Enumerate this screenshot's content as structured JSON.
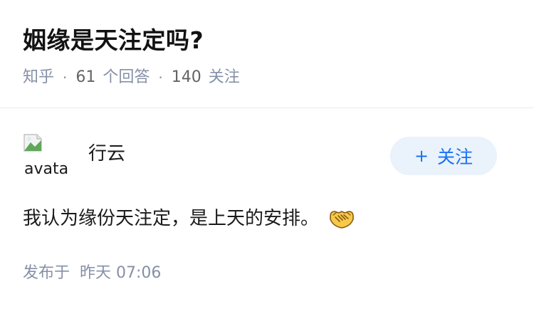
{
  "question": {
    "title": "姻缘是天注定吗?",
    "source": "知乎",
    "separator": "·",
    "answers_count": "61",
    "answers_label": "个回答",
    "followers_count": "140",
    "followers_label": "关注"
  },
  "answer": {
    "avatar_alt": "avatar",
    "author_name": "行云",
    "follow_button": {
      "plus": "+",
      "label": "关注"
    },
    "content": "我认为缘份天注定，是上天的安排。",
    "emoji_icon": "handshake-emoji-icon",
    "publish_label": "发布于",
    "publish_time": "昨天 07:06"
  },
  "colors": {
    "accent": "#1772f6",
    "follow_bg": "#eaf2fb",
    "meta_gray": "#8590a6",
    "text": "#1a1a1a"
  }
}
